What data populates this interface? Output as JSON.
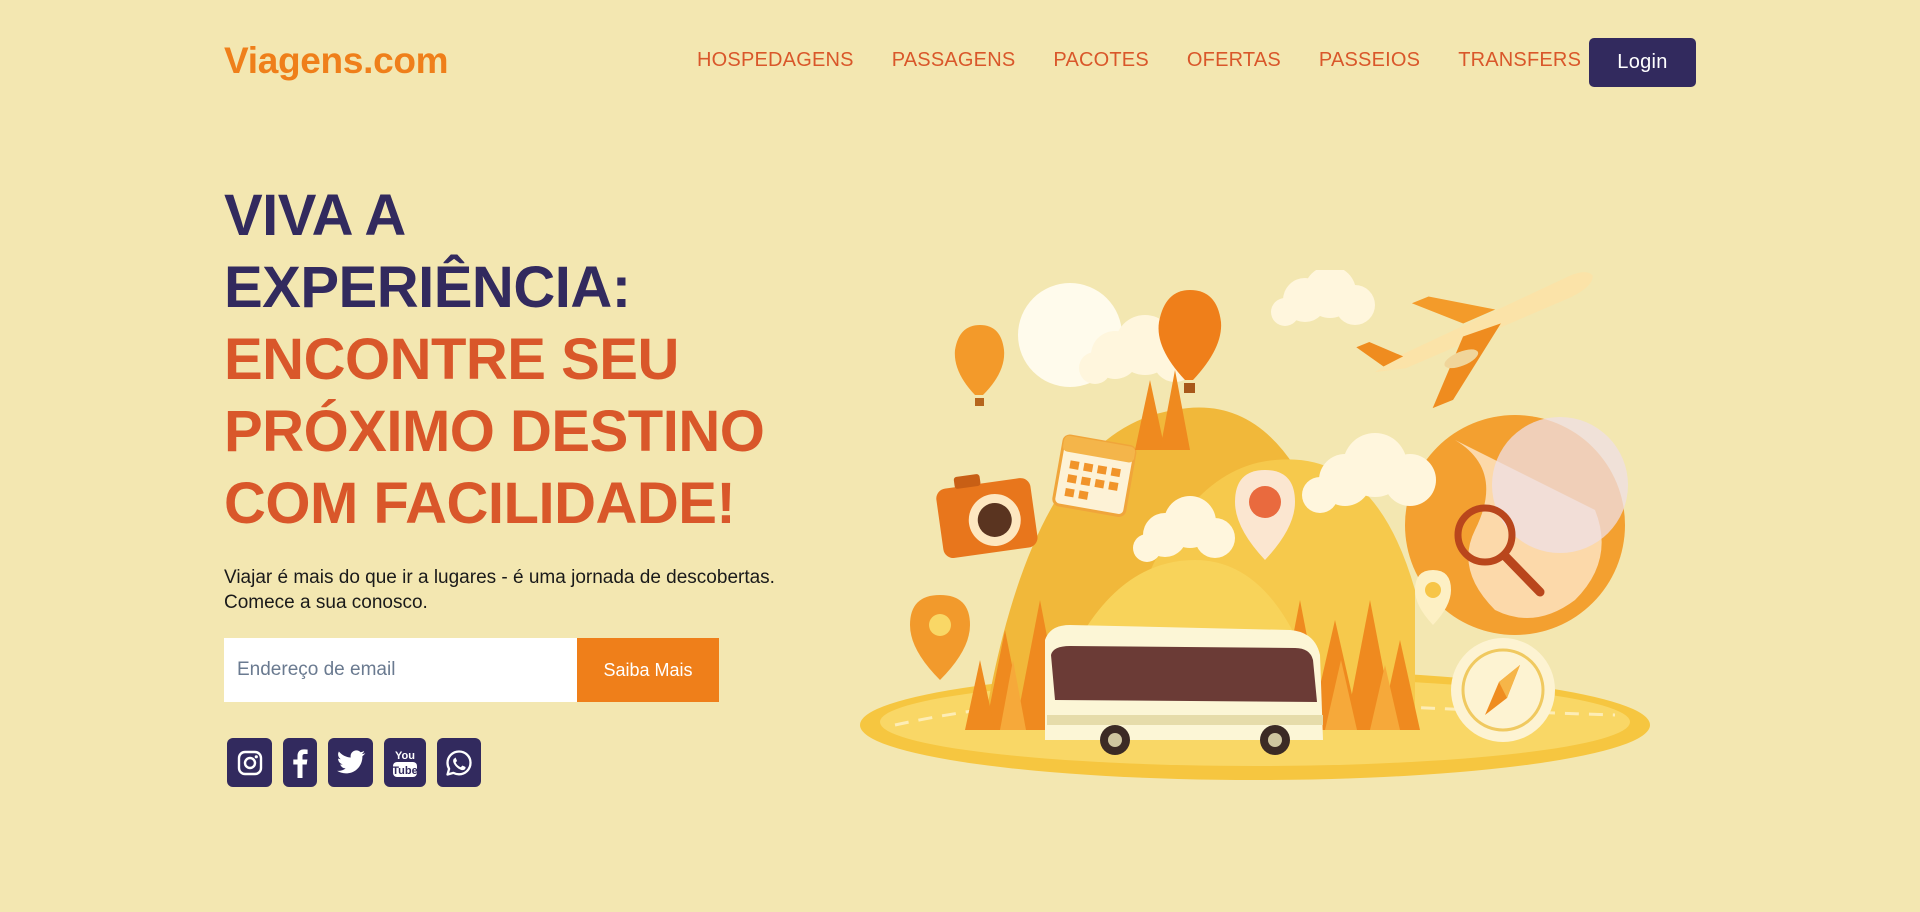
{
  "header": {
    "logo": "Viagens.com",
    "nav": [
      "HOSPEDAGENS",
      "PASSAGENS",
      "PACOTES",
      "OFERTAS",
      "PASSEIOS",
      "TRANSFERS"
    ],
    "login_label": "Login"
  },
  "hero": {
    "headline_dark": [
      "VIVA A",
      "EXPERIÊNCIA:"
    ],
    "headline_accent": [
      "ENCONTRE SEU",
      "PRÓXIMO DESTINO",
      "COM FACILIDADE!"
    ],
    "subtitle": [
      "Viajar é mais do que ir a lugares - é uma jornada de descobertas.",
      "Comece a sua conosco."
    ],
    "email_placeholder": "Endereço de email",
    "cta_label": "Saiba Mais"
  },
  "socials": [
    "instagram-icon",
    "facebook-icon",
    "twitter-icon",
    "youtube-icon",
    "whatsapp-icon"
  ],
  "colors": {
    "background": "#f3e7b1",
    "brand_orange": "#ef7f1a",
    "accent_red_orange": "#d9572a",
    "navy": "#322a5e"
  }
}
